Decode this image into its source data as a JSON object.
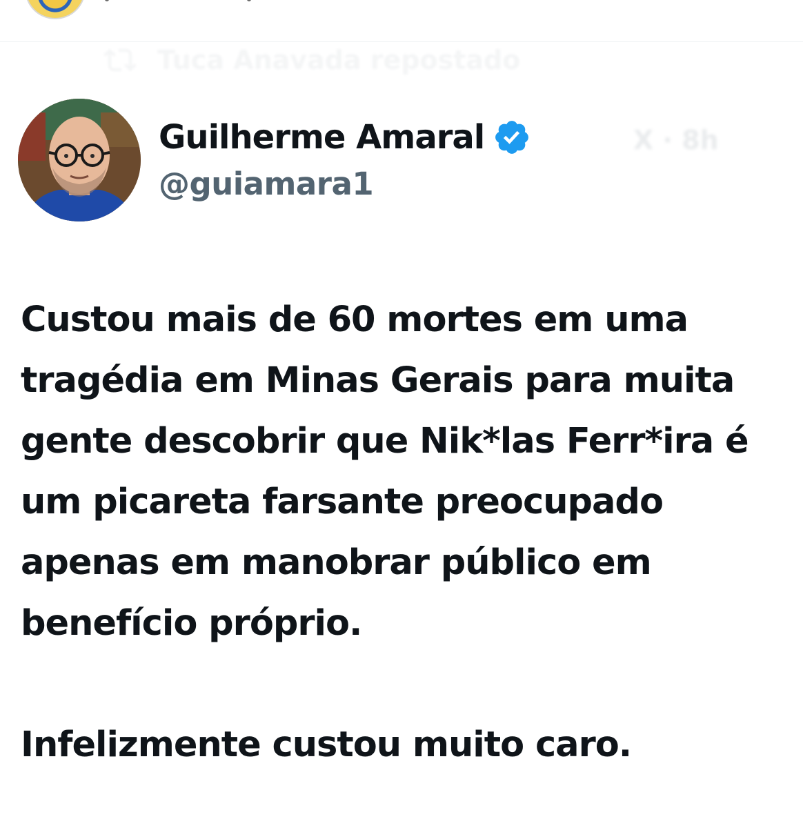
{
  "header_strip": {
    "avatar_icon": "profile-avatar-icon"
  },
  "retweet_context": {
    "icon": "retweet-icon",
    "text": "Tuca Anavada repostado"
  },
  "tweet": {
    "author": {
      "display_name": "Guilherme Amaral",
      "verified": true,
      "verified_color": "#1d9bf0",
      "handle": "@guiamara1",
      "avatar_icon": "author-avatar-icon"
    },
    "platform_mark": "X · 8h",
    "body": {
      "paragraph_1": "Custou mais de 60 mortes em uma tragédia em Minas Gerais para muita gente descobrir que Nik*las Ferr*ira é um picareta farsante preocupado apenas em manobrar público em benefício próprio.",
      "paragraph_2": "Infelizmente custou muito caro."
    }
  },
  "colors": {
    "text_primary": "#0f1419",
    "text_secondary": "#536471",
    "background": "#ffffff"
  }
}
